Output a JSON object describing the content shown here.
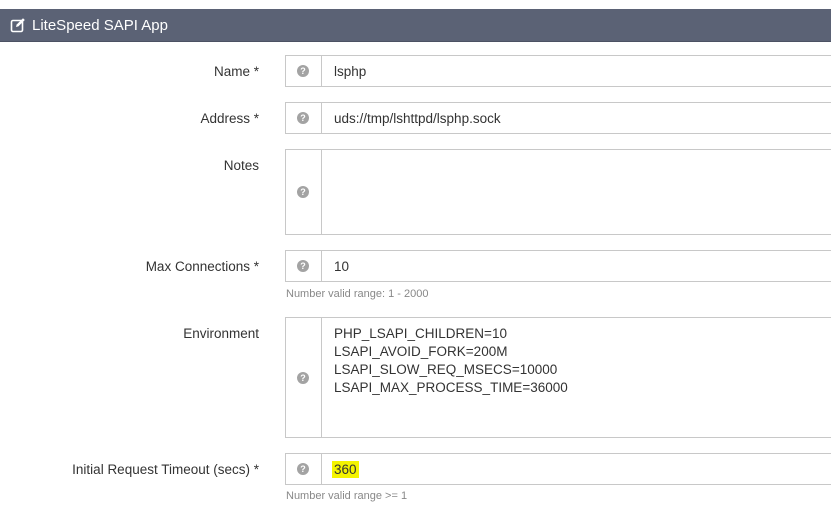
{
  "panel": {
    "title": "LiteSpeed SAPI App",
    "icon": "edit-icon",
    "header_color": "#5b6275"
  },
  "help_icon_glyph": "?",
  "fields": {
    "name": {
      "label": "Name *",
      "value": "lsphp"
    },
    "address": {
      "label": "Address *",
      "value": "uds://tmp/lshttpd/lsphp.sock"
    },
    "notes": {
      "label": "Notes",
      "value": ""
    },
    "max_connections": {
      "label": "Max Connections *",
      "value": "10",
      "hint": "Number valid range: 1 - 2000"
    },
    "environment": {
      "label": "Environment",
      "value": "PHP_LSAPI_CHILDREN=10\nLSAPI_AVOID_FORK=200M\nLSAPI_SLOW_REQ_MSECS=10000\nLSAPI_MAX_PROCESS_TIME=36000"
    },
    "initial_request_timeout": {
      "label": "Initial Request Timeout (secs) *",
      "value": "360",
      "hint": "Number valid range >= 1",
      "highlight_color": "#f4f400"
    }
  }
}
